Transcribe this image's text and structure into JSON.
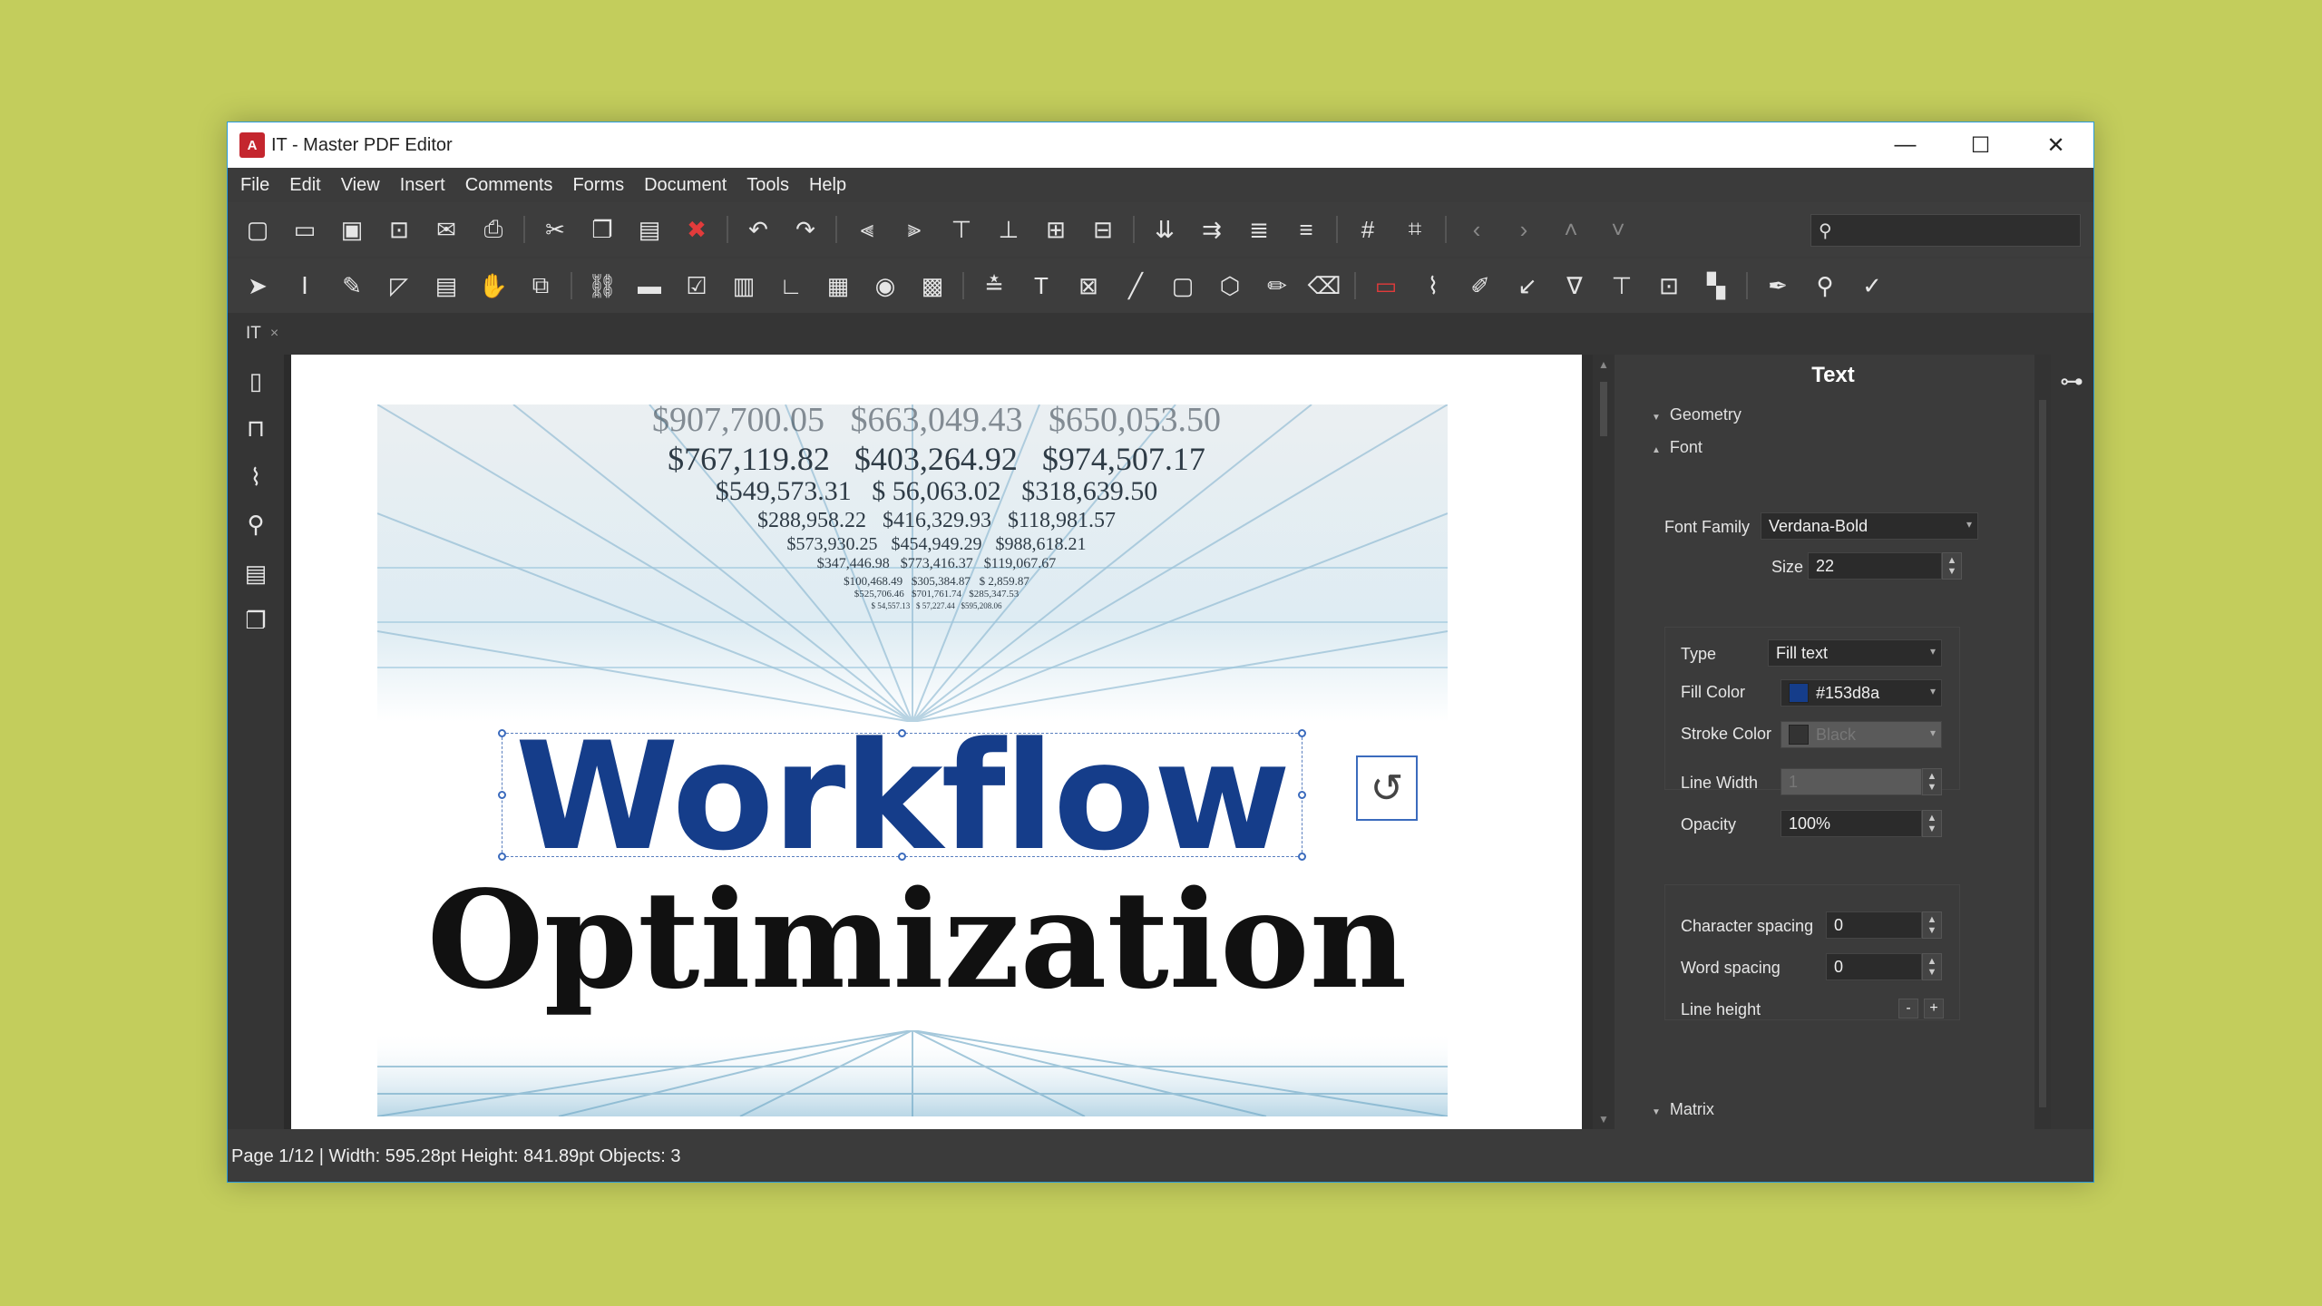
{
  "window": {
    "title": "IT - Master PDF Editor",
    "icon_label": "A",
    "controls": {
      "minimize": "—",
      "maximize": "☐",
      "close": "✕"
    }
  },
  "menu": [
    "File",
    "Edit",
    "View",
    "Insert",
    "Comments",
    "Forms",
    "Document",
    "Tools",
    "Help"
  ],
  "toolbar1_icons": [
    "new-document-icon",
    "open-folder-icon",
    "save-icon",
    "save-as-icon",
    "email-icon",
    "print-icon",
    "cut-icon",
    "copy-icon",
    "paste-icon",
    "delete-icon",
    "undo-icon",
    "redo-icon",
    "align-left-icon",
    "align-right-icon",
    "align-top-icon",
    "align-bottom-icon",
    "align-center-icon",
    "align-middle-icon",
    "arrange-icon",
    "arrange2-icon",
    "arrange3-icon",
    "arrange4-icon",
    "grid-icon",
    "grid-snap-icon",
    "prev-icon",
    "next-icon",
    "up-icon",
    "down-icon",
    "search-icon"
  ],
  "toolbar2_icons": [
    "select-arrow-icon",
    "text-select-icon",
    "edit-text-icon",
    "edit-object-icon",
    "form-icon",
    "hand-tool-icon",
    "crop-icon",
    "link-icon",
    "button-field-icon",
    "checkbox-icon",
    "combo-icon",
    "list-icon",
    "textfield-icon",
    "radio-icon",
    "image-field-icon",
    "add-text-icon",
    "text-tool-icon",
    "image-tool-icon",
    "line-tool-icon",
    "rect-tool-icon",
    "polygon-tool-icon",
    "pencil-icon",
    "eraser-icon",
    "comment-icon",
    "attach-icon",
    "highlight-icon",
    "arrow-tool-icon",
    "measure-icon",
    "textbox-icon",
    "stamp-icon",
    "qr-icon",
    "sign-icon",
    "zoom-icon",
    "check-icon"
  ],
  "doc_tab": {
    "label": "IT",
    "close": "×"
  },
  "document": {
    "title_line1": "Workflow",
    "title_line2": "Optimization",
    "number_rows": [
      "$907,700.05   $663,049.43   $650,053.50",
      "$767,119.82   $403,264.92   $974,507.17",
      "$549,573.31   $ 56,063.02   $318,639.50",
      "$288,958.22   $416,329.93   $118,981.57",
      "$573,930.25   $454,949.29   $988,618.21",
      "$347,446.98   $773,416.37   $119,067.67",
      "$100,468.49   $305,384.87   $ 2,859.87",
      "$525,706.46   $701,761.74   $285,347.53",
      "$ 54,557.13   $ 57,227.44   $595,208.06"
    ]
  },
  "panel": {
    "title": "Text",
    "sections": {
      "geometry": "Geometry",
      "font": "Font",
      "matrix": "Matrix"
    },
    "font_family_label": "Font Family",
    "font_family_value": "Verdana-Bold",
    "size_label": "Size",
    "size_value": "22",
    "type_label": "Type",
    "type_value": "Fill text",
    "fill_color_label": "Fill Color",
    "fill_color_value": "#153d8a",
    "stroke_color_label": "Stroke Color",
    "stroke_color_value": "Black",
    "line_width_label": "Line Width",
    "line_width_value": "1",
    "opacity_label": "Opacity",
    "opacity_value": "100%",
    "char_spacing_label": "Character spacing",
    "char_spacing_value": "0",
    "word_spacing_label": "Word spacing",
    "word_spacing_value": "0",
    "line_height_label": "Line height",
    "line_height_minus": "-",
    "line_height_plus": "+"
  },
  "status": "Page 1/12 | Width: 595.28pt Height: 841.89pt Objects: 3",
  "colors": {
    "fill": "#153d8a",
    "background": "#c3cd5c",
    "accent": "#2a9bd8"
  }
}
